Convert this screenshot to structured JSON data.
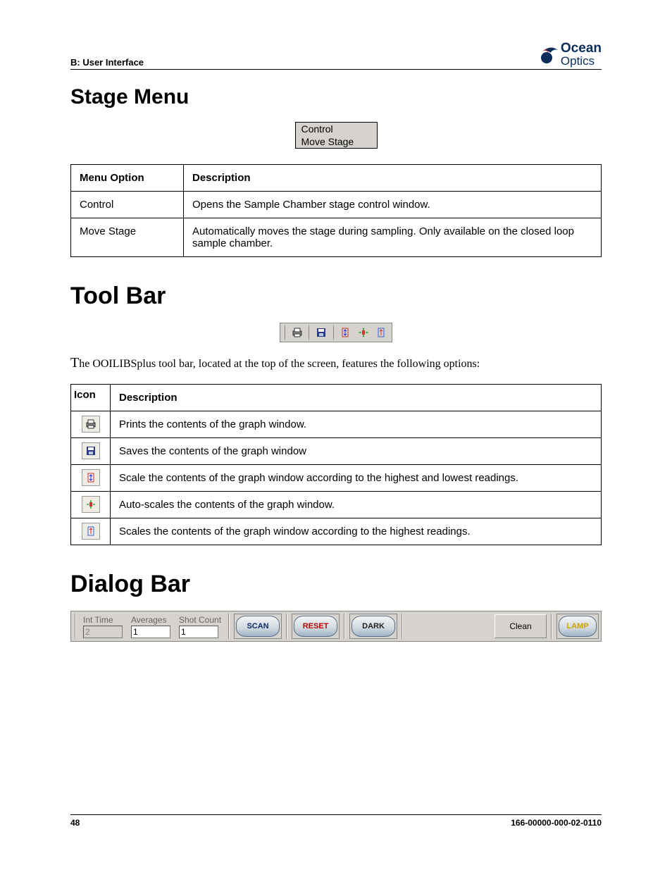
{
  "header": {
    "breadcrumb": "B: User Interface",
    "logo_top": "Ocean",
    "logo_bottom": "Optics"
  },
  "stage_menu": {
    "title": "Stage Menu",
    "menu_items": [
      "Control",
      "Move Stage"
    ],
    "cols": [
      "Menu Option",
      "Description"
    ],
    "rows": [
      {
        "opt": "Control",
        "desc": "Opens the Sample Chamber stage control window."
      },
      {
        "opt": "Move Stage",
        "desc": "Automatically moves the stage during sampling. Only available on the closed loop sample chamber."
      }
    ]
  },
  "toolbar": {
    "title": "Tool Bar",
    "intro_first": "T",
    "intro_rest": "he OOILIBSplus tool bar, located at the top of the screen, features the following options:",
    "cols": [
      "Icon",
      "Description"
    ],
    "rows": [
      {
        "icon": "print",
        "desc": "Prints the contents of the graph window."
      },
      {
        "icon": "save",
        "desc": "Saves the contents of the graph window"
      },
      {
        "icon": "scale-both",
        "desc": "Scale the contents of the graph window according to the highest and lowest readings."
      },
      {
        "icon": "autoscale",
        "desc": "Auto-scales the contents of the graph window."
      },
      {
        "icon": "scale-high",
        "desc": "Scales the contents of the graph window according to the highest readings."
      }
    ]
  },
  "dialog": {
    "title": "Dialog Bar",
    "fields": {
      "int_time": {
        "label": "Int Time",
        "value": "2",
        "disabled": true
      },
      "averages": {
        "label": "Averages",
        "value": "1",
        "disabled": false
      },
      "shot_count": {
        "label": "Shot Count",
        "value": "1",
        "disabled": false
      }
    },
    "buttons": {
      "scan": "SCAN",
      "reset": "RESET",
      "dark": "DARK",
      "clean": "Clean",
      "lamp": "LAMP"
    }
  },
  "footer": {
    "page": "48",
    "doc": "166-00000-000-02-0110"
  }
}
